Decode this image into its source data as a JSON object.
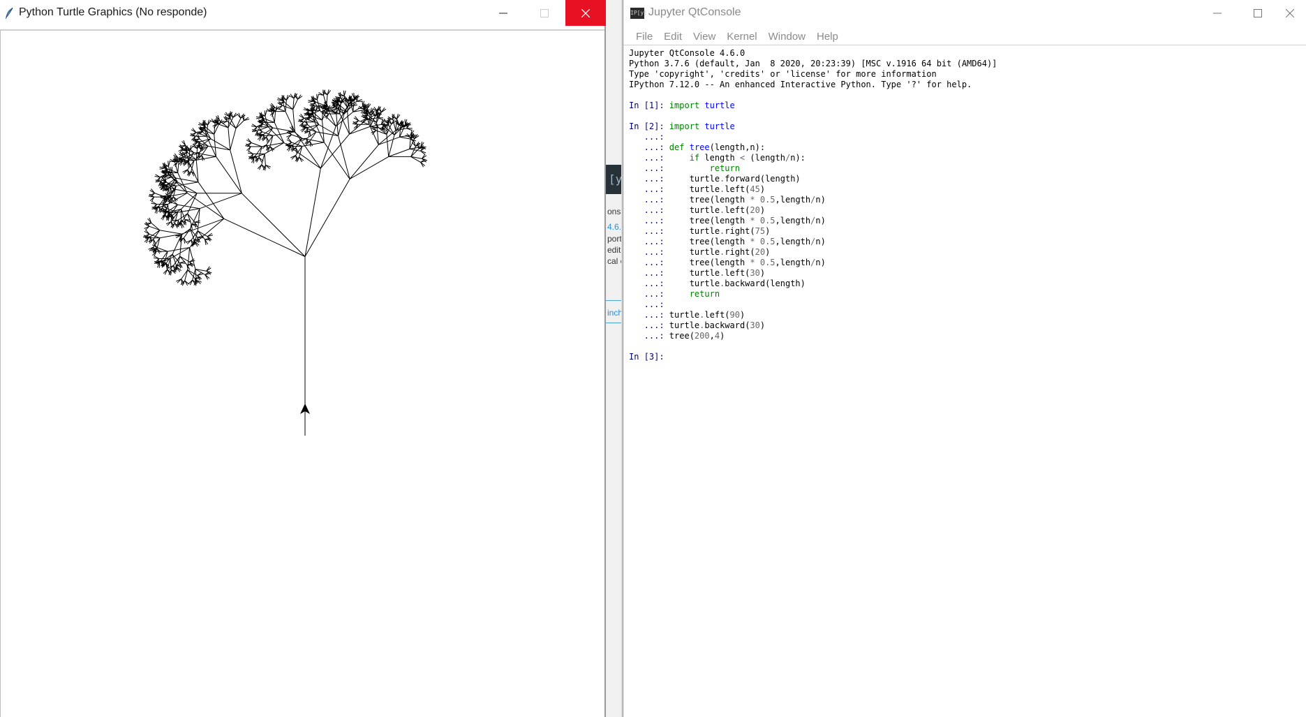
{
  "turtle_window": {
    "title": "Python Turtle Graphics (No responde)",
    "icon": "feather-icon",
    "controls": [
      "minimize",
      "maximize-disabled",
      "close"
    ]
  },
  "background_window": {
    "dark_strip_text": "[y",
    "fragments": [
      "ons",
      "4.6.",
      "port",
      "edit",
      "cal c",
      "inch"
    ]
  },
  "jupyter_window": {
    "title": "Jupyter QtConsole",
    "logo_text": "IP[y]:",
    "menu": [
      "File",
      "Edit",
      "View",
      "Kernel",
      "Window",
      "Help"
    ],
    "banner": [
      "Jupyter QtConsole 4.6.0",
      "Python 3.7.6 (default, Jan  8 2020, 20:23:39) [MSC v.1916 64 bit (AMD64)]",
      "Type 'copyright', 'credits' or 'license' for more information",
      "IPython 7.12.0 -- An enhanced Interactive Python. Type '?' for help."
    ],
    "cells": [
      {
        "prompt": "In [1]: ",
        "lines": [
          [
            {
              "t": "import",
              "c": "kw"
            },
            {
              "t": " turtle",
              "c": "mod"
            }
          ]
        ]
      },
      {
        "prompt": "In [2]: ",
        "lines": [
          [
            {
              "t": "import",
              "c": "kw"
            },
            {
              "t": " turtle",
              "c": "mod"
            }
          ],
          [],
          [
            {
              "t": "def",
              "c": "kw"
            },
            {
              "t": " "
            },
            {
              "t": "tree",
              "c": "fn"
            },
            {
              "t": "(length,n):"
            }
          ],
          [
            {
              "t": "    "
            },
            {
              "t": "if",
              "c": "kw"
            },
            {
              "t": " length "
            },
            {
              "t": "<",
              "c": "op"
            },
            {
              "t": " (length"
            },
            {
              "t": "/",
              "c": "op"
            },
            {
              "t": "n):"
            }
          ],
          [
            {
              "t": "        "
            },
            {
              "t": "return",
              "c": "kw"
            }
          ],
          [
            {
              "t": "    turtle"
            },
            {
              "t": ".",
              "c": "op"
            },
            {
              "t": "forward(length)"
            }
          ],
          [
            {
              "t": "    turtle"
            },
            {
              "t": ".",
              "c": "op"
            },
            {
              "t": "left("
            },
            {
              "t": "45",
              "c": "num"
            },
            {
              "t": ")"
            }
          ],
          [
            {
              "t": "    tree(length "
            },
            {
              "t": "*",
              "c": "op"
            },
            {
              "t": " "
            },
            {
              "t": "0.5",
              "c": "num"
            },
            {
              "t": ",length"
            },
            {
              "t": "/",
              "c": "op"
            },
            {
              "t": "n)"
            }
          ],
          [
            {
              "t": "    turtle"
            },
            {
              "t": ".",
              "c": "op"
            },
            {
              "t": "left("
            },
            {
              "t": "20",
              "c": "num"
            },
            {
              "t": ")"
            }
          ],
          [
            {
              "t": "    tree(length "
            },
            {
              "t": "*",
              "c": "op"
            },
            {
              "t": " "
            },
            {
              "t": "0.5",
              "c": "num"
            },
            {
              "t": ",length"
            },
            {
              "t": "/",
              "c": "op"
            },
            {
              "t": "n)"
            }
          ],
          [
            {
              "t": "    turtle"
            },
            {
              "t": ".",
              "c": "op"
            },
            {
              "t": "right("
            },
            {
              "t": "75",
              "c": "num"
            },
            {
              "t": ")"
            }
          ],
          [
            {
              "t": "    tree(length "
            },
            {
              "t": "*",
              "c": "op"
            },
            {
              "t": " "
            },
            {
              "t": "0.5",
              "c": "num"
            },
            {
              "t": ",length"
            },
            {
              "t": "/",
              "c": "op"
            },
            {
              "t": "n)"
            }
          ],
          [
            {
              "t": "    turtle"
            },
            {
              "t": ".",
              "c": "op"
            },
            {
              "t": "right("
            },
            {
              "t": "20",
              "c": "num"
            },
            {
              "t": ")"
            }
          ],
          [
            {
              "t": "    tree(length "
            },
            {
              "t": "*",
              "c": "op"
            },
            {
              "t": " "
            },
            {
              "t": "0.5",
              "c": "num"
            },
            {
              "t": ",length"
            },
            {
              "t": "/",
              "c": "op"
            },
            {
              "t": "n)"
            }
          ],
          [
            {
              "t": "    turtle"
            },
            {
              "t": ".",
              "c": "op"
            },
            {
              "t": "left("
            },
            {
              "t": "30",
              "c": "num"
            },
            {
              "t": ")"
            }
          ],
          [
            {
              "t": "    turtle"
            },
            {
              "t": ".",
              "c": "op"
            },
            {
              "t": "backward(length)"
            }
          ],
          [
            {
              "t": "    "
            },
            {
              "t": "return",
              "c": "kw"
            }
          ],
          [],
          [
            {
              "t": "turtle"
            },
            {
              "t": ".",
              "c": "op"
            },
            {
              "t": "left("
            },
            {
              "t": "90",
              "c": "num"
            },
            {
              "t": ")"
            }
          ],
          [
            {
              "t": "turtle"
            },
            {
              "t": ".",
              "c": "op"
            },
            {
              "t": "backward("
            },
            {
              "t": "30",
              "c": "num"
            },
            {
              "t": ")"
            }
          ],
          [
            {
              "t": "tree("
            },
            {
              "t": "200",
              "c": "num"
            },
            {
              "t": ","
            },
            {
              "t": "4",
              "c": "num"
            },
            {
              "t": ")"
            }
          ]
        ]
      },
      {
        "prompt": "In [3]: ",
        "lines": [
          []
        ]
      }
    ],
    "continuation_prompt": "   ...: "
  },
  "colors": {
    "close_red": "#e81123",
    "prompt_blue": "#000080",
    "keyword_green": "#008000",
    "name_blue": "#0000ff",
    "literal_gray": "#666666"
  }
}
